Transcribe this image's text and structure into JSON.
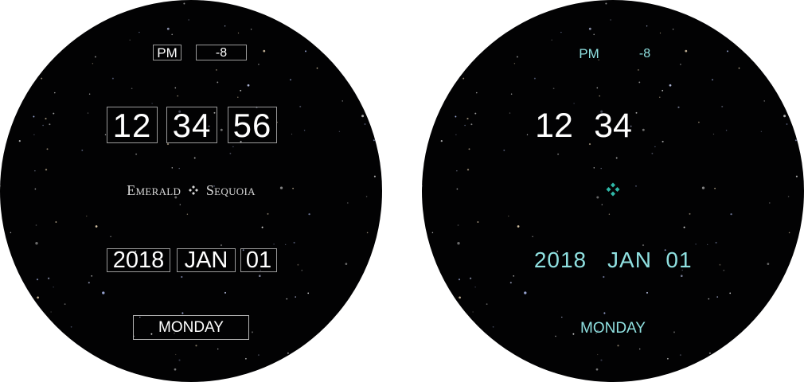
{
  "watch_faces": [
    {
      "mode": "active",
      "ampm": "PM",
      "timezone_offset": "-8",
      "time": {
        "hours": "12",
        "minutes": "34",
        "seconds": "56"
      },
      "brand": {
        "left": "Emerald",
        "right": "Sequoia"
      },
      "date": {
        "year": "2018",
        "month": "JAN",
        "day": "01"
      },
      "weekday": "MONDAY"
    },
    {
      "mode": "ambient",
      "ampm": "PM",
      "timezone_offset": "-8",
      "time": {
        "hours": "12",
        "minutes": "34"
      },
      "date": {
        "year": "2018",
        "month": "JAN",
        "day": "01"
      },
      "weekday": "MONDAY"
    }
  ],
  "colors": {
    "face_background": "#020203",
    "text_white": "#ffffff",
    "ambient_accent": "#8fe0e0",
    "logo_teal": "#2fb8a8",
    "box_border": "#9a9a9a"
  },
  "icons": {
    "brand_logo": "four-diamond-icon"
  }
}
